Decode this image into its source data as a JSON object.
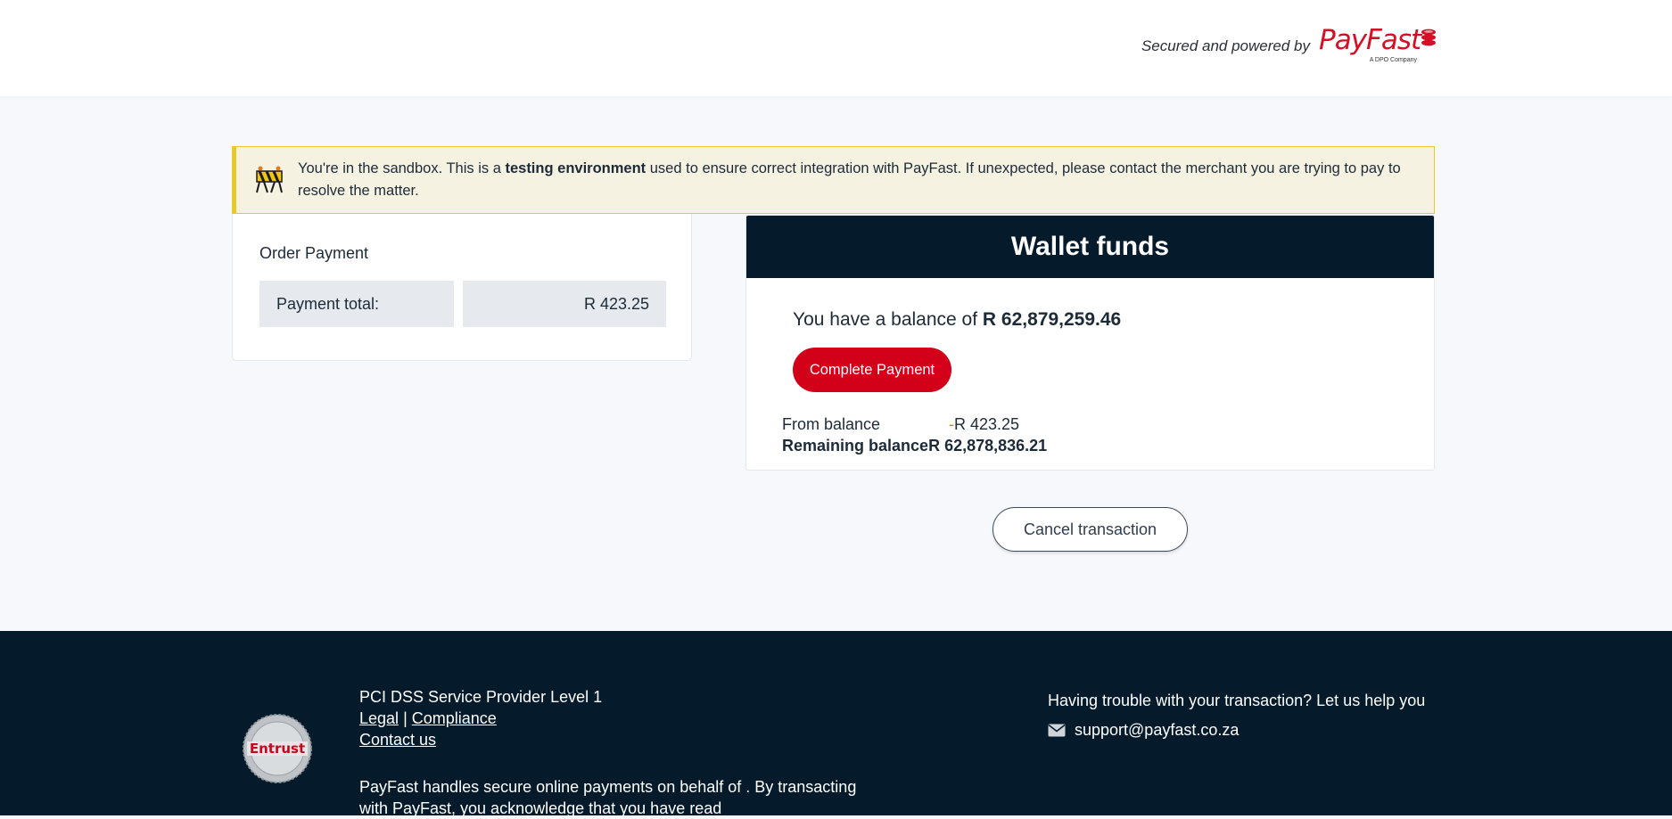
{
  "header": {
    "secured_text": "Secured and powered by",
    "logo_word": "PayFast",
    "logo_sub": "A DPO Company",
    "brand_color": "#d50f25"
  },
  "sandbox": {
    "text_before": "You're in the sandbox. This is a ",
    "text_bold": "testing environment",
    "text_after": " used to ensure correct integration with PayFast. If unexpected, please contact the merchant you are trying to pay to resolve the matter.",
    "icon": "construction-barrier-icon"
  },
  "order": {
    "title": "Order Payment",
    "total_label": "Payment total:",
    "total_value": "R 423.25"
  },
  "wallet": {
    "title": "Wallet funds",
    "balance_prefix": "You have a balance of ",
    "balance_amount": "R 62,879,259.46",
    "complete_label": "Complete Payment",
    "from_label": "From balance",
    "from_sign": "-",
    "from_value": "R 423.25",
    "remaining_label": "Remaining balance",
    "remaining_value": "R 62,878,836.21"
  },
  "cancel_label": "Cancel transaction",
  "footer": {
    "pci": "PCI DSS Service Provider Level 1",
    "legal": "Legal",
    "separator": "|",
    "compliance": "Compliance",
    "contact": "Contact us",
    "paragraph": "PayFast handles secure online payments on behalf of . By transacting with PayFast, you acknowledge that you have read",
    "help": "Having trouble with your transaction? Let us help you",
    "email": "support@payfast.co.za",
    "seal_text": "Entrust"
  },
  "colors": {
    "accent_red": "#d20019",
    "navy": "#051a2b",
    "sandbox_bg": "#f6f2e2",
    "sandbox_border": "#e9c928"
  }
}
